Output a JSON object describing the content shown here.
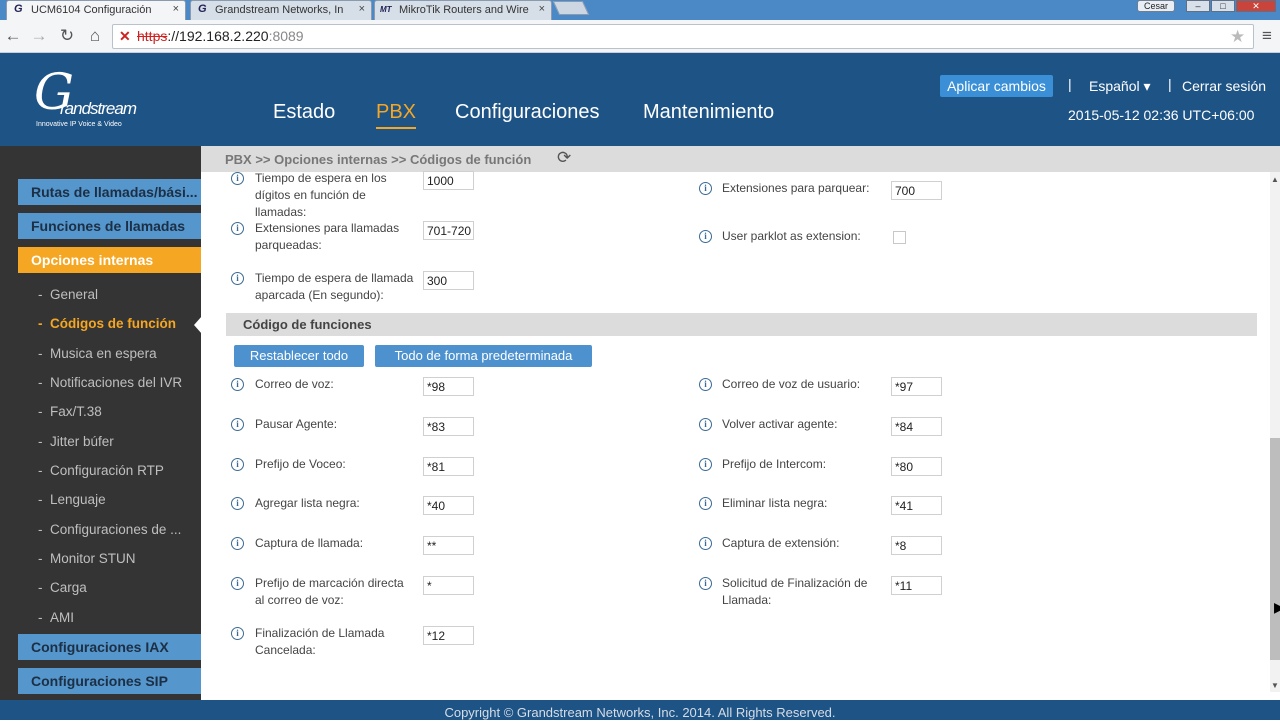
{
  "browser": {
    "tabs": [
      {
        "title": "UCM6104 Configuración",
        "icon": "G"
      },
      {
        "title": "Grandstream Networks, In",
        "icon": "G"
      },
      {
        "title": "MikroTik Routers and Wire",
        "icon": "MT"
      }
    ],
    "user": "Cesar",
    "url": {
      "scheme": "https",
      "host": "://192.168.2.220",
      "port": ":8089"
    }
  },
  "header": {
    "logo": {
      "mark": "G",
      "name": "randstream",
      "tagline": "Innovative IP Voice & Video"
    },
    "nav": [
      "Estado",
      "PBX",
      "Configuraciones",
      "Mantenimiento"
    ],
    "apply_label": "Aplicar cambios",
    "language": "Español",
    "logout": "Cerrar sesión",
    "datetime": "2015-05-12 02:36 UTC+06:00",
    "separator": "|"
  },
  "breadcrumb": "PBX >> Opciones internas >> Códigos de función",
  "sidebar": {
    "sections": [
      "Rutas de llamadas/bási...",
      "Funciones de llamadas",
      "Opciones internas",
      "Configuraciones IAX",
      "Configuraciones SIP"
    ],
    "items": [
      "General",
      "Códigos de función",
      "Musica en espera",
      "Notificaciones del IVR",
      "Fax/T.38",
      "Jitter búfer",
      "Configuración RTP",
      "Lenguaje",
      "Configuraciones de ...",
      "Monitor STUN",
      "Carga",
      "AMI"
    ],
    "bullet": "-"
  },
  "top_fields": {
    "left": [
      {
        "label": "Tiempo de espera en los dígitos en función de llamadas:",
        "value": "1000"
      },
      {
        "label": "Extensiones para llamadas parqueadas:",
        "value": "701-720"
      },
      {
        "label": "Tiempo de espera de llamada aparcada (En segundo):",
        "value": "300"
      }
    ],
    "right": [
      {
        "label": "Extensiones para parquear:",
        "value": "700"
      },
      {
        "label": "User parklot as extension:",
        "checked": false
      }
    ]
  },
  "section_title": "Código de funciones",
  "buttons": {
    "reset_all": "Restablecer todo",
    "all_default": "Todo de forma predeterminada"
  },
  "feature_codes": {
    "left": [
      {
        "label": "Correo de voz:",
        "value": "*98"
      },
      {
        "label": "Pausar Agente:",
        "value": "*83"
      },
      {
        "label": "Prefijo de Voceo:",
        "value": "*81"
      },
      {
        "label": "Agregar lista negra:",
        "value": "*40"
      },
      {
        "label": "Captura de llamada:",
        "value": "**"
      },
      {
        "label": "Prefijo de marcación directa al correo de voz:",
        "value": "*"
      },
      {
        "label": "Finalización de Llamada Cancelada:",
        "value": "*12"
      }
    ],
    "right": [
      {
        "label": "Correo de voz de usuario:",
        "value": "*97"
      },
      {
        "label": "Volver activar agente:",
        "value": "*84"
      },
      {
        "label": "Prefijo de Intercom:",
        "value": "*80"
      },
      {
        "label": "Eliminar lista negra:",
        "value": "*41"
      },
      {
        "label": "Captura de extensión:",
        "value": "*8"
      },
      {
        "label": "Solicitud de Finalización de Llamada:",
        "value": "*11"
      }
    ]
  },
  "footer": "Copyright © Grandstream Networks, Inc. 2014. All Rights Reserved.",
  "colors": {
    "header": "#1e5385",
    "accent": "#f5a623",
    "sidebar": "#343434",
    "section": "#5596cc",
    "button": "#4d92cf"
  },
  "icons": {
    "info": "i",
    "refresh": "⟳",
    "back": "←",
    "forward": "→",
    "reload": "↻",
    "home": "⌂",
    "star": "★",
    "menu": "≡",
    "close": "×",
    "caret": "▾",
    "up": "▲",
    "down": "▼"
  }
}
